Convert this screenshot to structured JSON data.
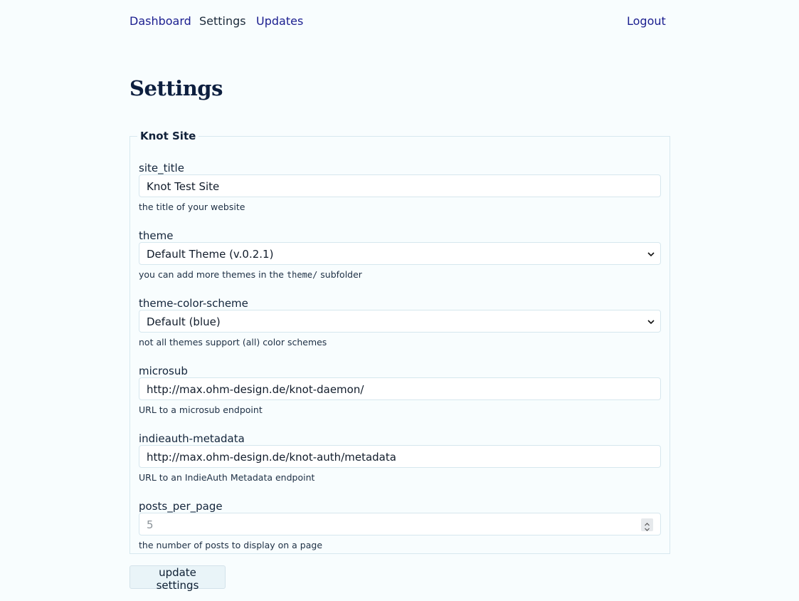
{
  "nav": {
    "dashboard": "Dashboard",
    "settings": "Settings",
    "updates": "Updates",
    "logout": "Logout"
  },
  "page_title": "Settings",
  "fieldset": {
    "legend": "Knot Site",
    "fields": [
      {
        "label": "site_title",
        "value": "Knot Test Site",
        "help": "the title of your website"
      },
      {
        "label": "theme",
        "value": "Default Theme (v.0.2.1)",
        "help_prefix": "you can add more themes in the ",
        "help_code": "theme/",
        "help_suffix": " subfolder"
      },
      {
        "label": "theme-color-scheme",
        "value": "Default (blue)",
        "help": "not all themes support (all) color schemes"
      },
      {
        "label": "microsub",
        "value": "http://max.ohm-design.de/knot-daemon/",
        "help": "URL to a microsub endpoint"
      },
      {
        "label": "indieauth-metadata",
        "value": "http://max.ohm-design.de/knot-auth/metadata",
        "help": "URL to an IndieAuth Metadata endpoint"
      },
      {
        "label": "posts_per_page",
        "value": "5",
        "help": "the number of posts to display on a page"
      }
    ]
  },
  "submit_label": "update settings"
}
